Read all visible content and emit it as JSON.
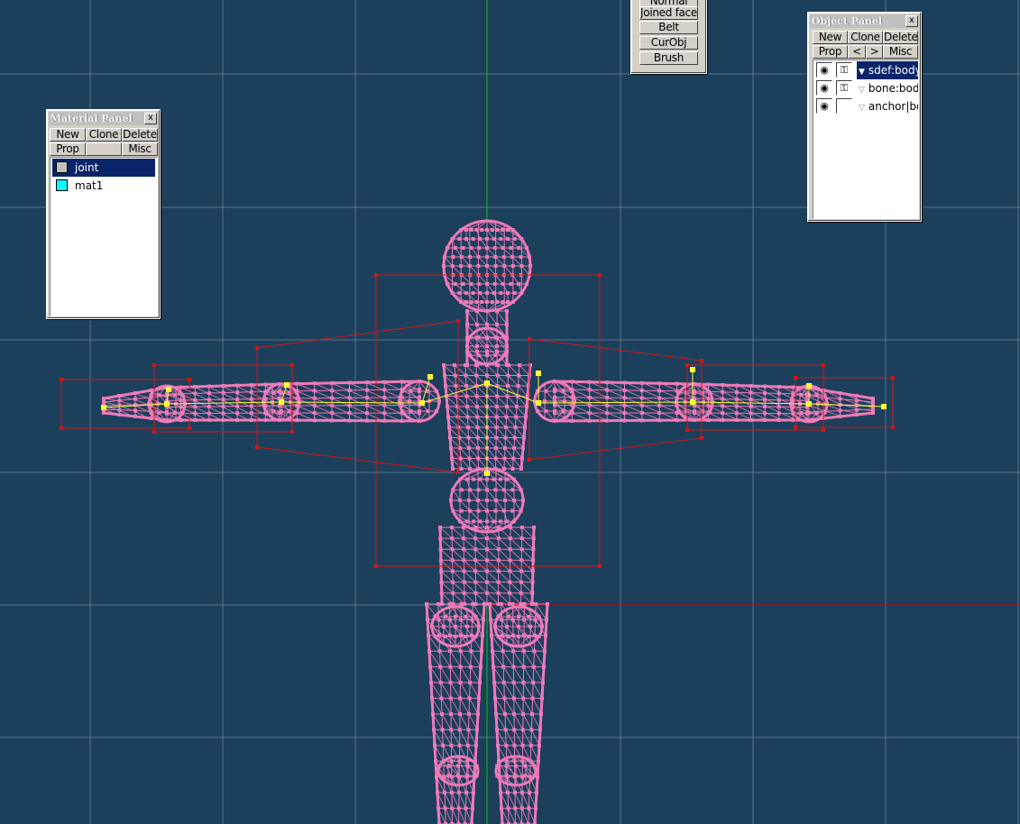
{
  "material_panel": {
    "title": "Material Panel",
    "close": "x",
    "buttons": {
      "new": "New",
      "clone": "Clone",
      "delete": "Delete",
      "prop": "Prop",
      "misc": "Misc"
    },
    "items": [
      {
        "label": "joint",
        "color": "#c0c0c0",
        "selected": true
      },
      {
        "label": "mat1",
        "color": "#00ffff",
        "selected": false
      }
    ]
  },
  "top_menu": {
    "items": [
      {
        "label": "Normal"
      },
      {
        "label": "Joined face"
      },
      {
        "label": "Belt"
      },
      {
        "label": "CurObj"
      },
      {
        "label": "Brush"
      }
    ]
  },
  "object_panel": {
    "title": "Object Panel",
    "close": "x",
    "buttons": {
      "new": "New",
      "clone": "Clone",
      "delete": "Delete",
      "prop": "Prop",
      "prev": "<",
      "next": ">",
      "misc": "Misc"
    },
    "items": [
      {
        "label": "sdef:body",
        "selected": true,
        "visible_icon": "eye-icon",
        "lock_icon": "key-icon",
        "expand": "▼"
      },
      {
        "label": "bone:body",
        "selected": false,
        "visible_icon": "eye-icon",
        "lock_icon": "key-icon",
        "expand": "▽"
      },
      {
        "label": "anchor|body",
        "selected": false,
        "visible_icon": "eye-icon",
        "lock_icon": "",
        "expand": "▽"
      }
    ]
  },
  "colors": {
    "viewport_bg": "#1c3f5c",
    "grid": "#8aa0b4",
    "mesh": "#f07ab8",
    "bone": "#ffff33",
    "anchor": "#d01818",
    "axis_y": "#00c800",
    "axis_x": "#c80000"
  }
}
